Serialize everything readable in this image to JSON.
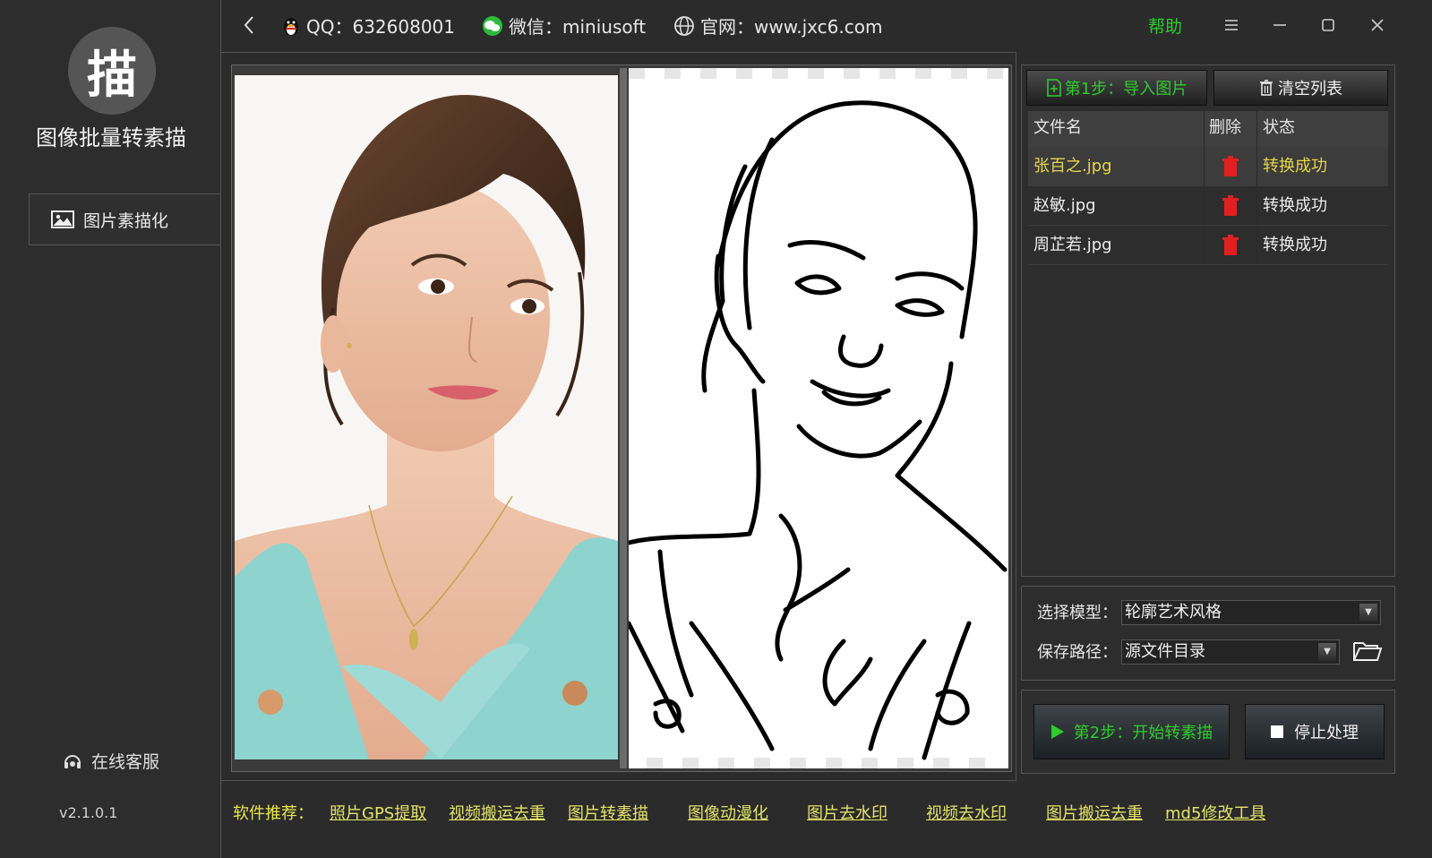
{
  "app": {
    "logo_char": "描",
    "title": "图像批量转素描",
    "version": "v2.1.0.1"
  },
  "sidebar": {
    "nav": [
      {
        "label": "图片素描化",
        "icon": "image-icon"
      }
    ],
    "support_label": "在线客服"
  },
  "header": {
    "qq": "QQ：632608001",
    "wechat": "微信：miniusoft",
    "website": "官网：www.jxc6.com",
    "help": "帮助"
  },
  "toolbar": {
    "import_label": "第1步：导入图片",
    "clear_label": "清空列表"
  },
  "file_table": {
    "columns": [
      "文件名",
      "删除",
      "状态"
    ],
    "rows": [
      {
        "name": "张百之.jpg",
        "status": "转换成功",
        "selected": true
      },
      {
        "name": "赵敏.jpg",
        "status": "转换成功",
        "selected": false
      },
      {
        "name": "周芷若.jpg",
        "status": "转换成功",
        "selected": false
      }
    ]
  },
  "settings": {
    "model_label": "选择模型：",
    "model_value": "轮廓艺术风格",
    "path_label": "保存路径：",
    "path_value": "源文件目录"
  },
  "actions": {
    "start_label": "第2步：开始转素描",
    "stop_label": "停止处理"
  },
  "footer": {
    "label": "软件推荐：",
    "links": [
      "照片GPS提取",
      "视频搬运去重",
      "图片转素描",
      "图像动漫化",
      "图片去水印",
      "视频去水印",
      "图片搬运去重",
      "md5修改工具"
    ]
  },
  "colors": {
    "accent_green": "#2ecc2e",
    "selected_text": "#e5d64a",
    "delete_red": "#e02020",
    "link_yellow": "#e3e36a"
  }
}
